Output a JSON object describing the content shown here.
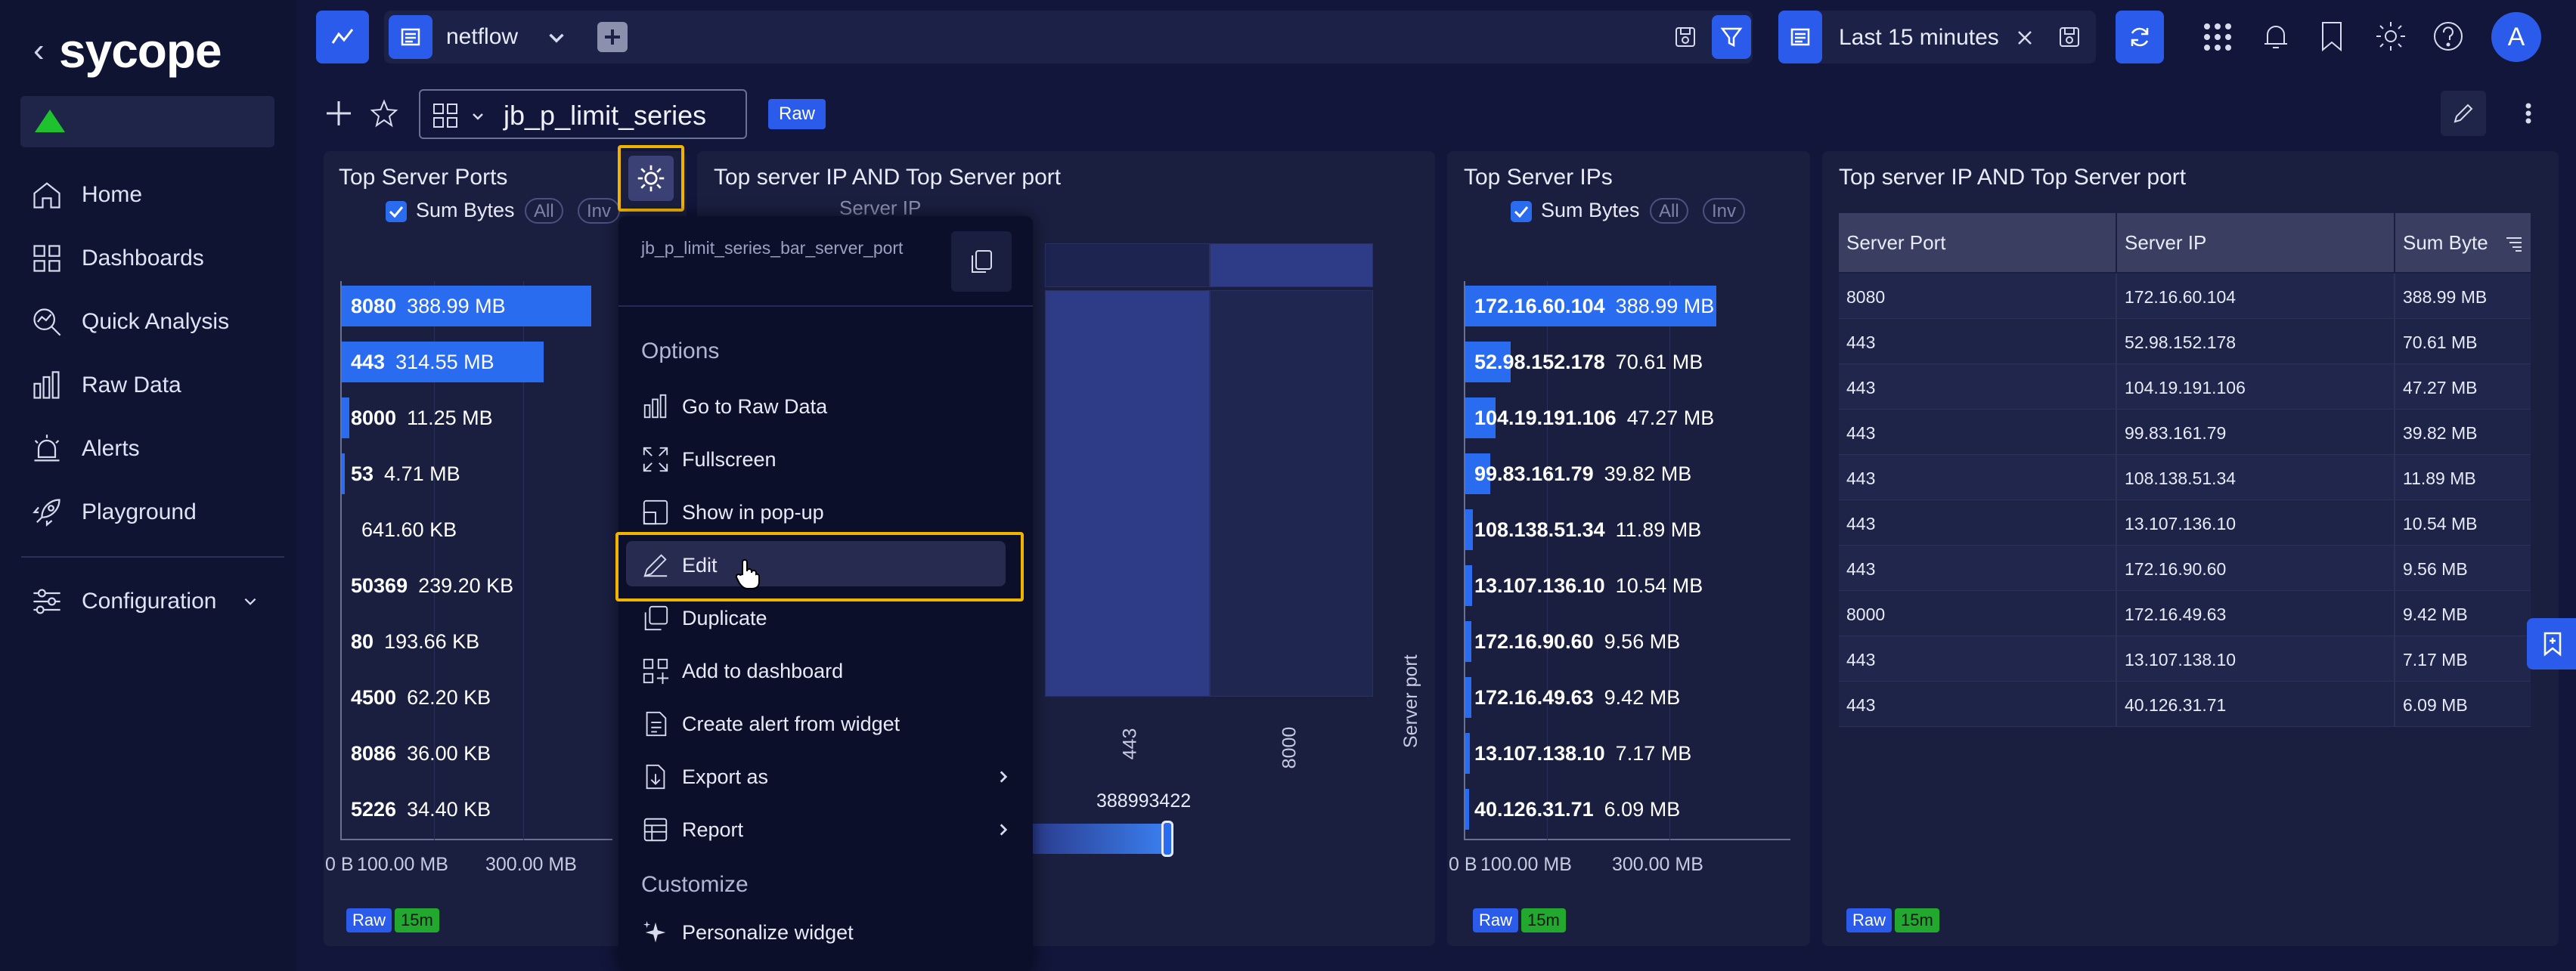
{
  "brand": {
    "logo_text": "sycope",
    "back_glyph": "‹"
  },
  "sidebar": {
    "items": [
      {
        "label": "Home"
      },
      {
        "label": "Dashboards"
      },
      {
        "label": "Quick Analysis"
      },
      {
        "label": "Raw Data"
      },
      {
        "label": "Alerts"
      },
      {
        "label": "Playground"
      },
      {
        "label": "Configuration"
      }
    ]
  },
  "topbar": {
    "source": "netflow",
    "time_range": "Last 15 minutes",
    "avatar": "A"
  },
  "dashboard": {
    "name": "jb_p_limit_series",
    "badge": "Raw"
  },
  "widgets": {
    "ports": {
      "title": "Top Server Ports",
      "series_label": "Sum Bytes",
      "pill_all": "All",
      "pill_inv": "Inv",
      "rows": [
        {
          "k": "8080",
          "v": "388.99 MB",
          "frac": 1.0
        },
        {
          "k": "443",
          "v": "314.55 MB",
          "frac": 0.81
        },
        {
          "k": "8000",
          "v": "11.25 MB",
          "frac": 0.03
        },
        {
          "k": "53",
          "v": "4.71 MB",
          "frac": 0.012
        },
        {
          "k": "",
          "v": "641.60 KB",
          "frac": 0.0
        },
        {
          "k": "50369",
          "v": "239.20 KB",
          "frac": 0.0
        },
        {
          "k": "80",
          "v": "193.66 KB",
          "frac": 0.0
        },
        {
          "k": "4500",
          "v": "62.20 KB",
          "frac": 0.0
        },
        {
          "k": "8086",
          "v": "36.00 KB",
          "frac": 0.0
        },
        {
          "k": "5226",
          "v": "34.40 KB",
          "frac": 0.0
        }
      ],
      "axis_ticks": [
        "0 B",
        "100.00 MB",
        "300.00 MB"
      ],
      "tag_raw": "Raw",
      "tag_time": "15m"
    },
    "heatmap": {
      "title": "Top server IP AND Top Server port",
      "x_title": "Server IP",
      "y_title": "Server port",
      "y_ticks": [
        "443",
        "8000"
      ],
      "legend_max": "388993422"
    },
    "ips": {
      "title": "Top Server IPs",
      "series_label": "Sum Bytes",
      "pill_all": "All",
      "pill_inv": "Inv",
      "rows": [
        {
          "k": "172.16.60.104",
          "v": "388.99 MB",
          "frac": 1.0
        },
        {
          "k": "52.98.152.178",
          "v": "70.61 MB",
          "frac": 0.18
        },
        {
          "k": "104.19.191.106",
          "v": "47.27 MB",
          "frac": 0.12
        },
        {
          "k": "99.83.161.79",
          "v": "39.82 MB",
          "frac": 0.1
        },
        {
          "k": "108.138.51.34",
          "v": "11.89 MB",
          "frac": 0.03
        },
        {
          "k": "13.107.136.10",
          "v": "10.54 MB",
          "frac": 0.027
        },
        {
          "k": "172.16.90.60",
          "v": "9.56 MB",
          "frac": 0.025
        },
        {
          "k": "172.16.49.63",
          "v": "9.42 MB",
          "frac": 0.024
        },
        {
          "k": "13.107.138.10",
          "v": "7.17 MB",
          "frac": 0.018
        },
        {
          "k": "40.126.31.71",
          "v": "6.09 MB",
          "frac": 0.016
        }
      ],
      "axis_ticks": [
        "0 B",
        "100.00 MB",
        "300.00 MB"
      ],
      "tag_raw": "Raw",
      "tag_time": "15m"
    },
    "table": {
      "title": "Top server IP AND Top Server port",
      "columns": [
        "Server Port",
        "Server IP",
        "Sum Byte"
      ],
      "rows": [
        [
          "8080",
          "172.16.60.104",
          "388.99 MB"
        ],
        [
          "443",
          "52.98.152.178",
          "70.61 MB"
        ],
        [
          "443",
          "104.19.191.106",
          "47.27 MB"
        ],
        [
          "443",
          "99.83.161.79",
          "39.82 MB"
        ],
        [
          "443",
          "108.138.51.34",
          "11.89 MB"
        ],
        [
          "443",
          "13.107.136.10",
          "10.54 MB"
        ],
        [
          "443",
          "172.16.90.60",
          "9.56 MB"
        ],
        [
          "8000",
          "172.16.49.63",
          "9.42 MB"
        ],
        [
          "443",
          "13.107.138.10",
          "7.17 MB"
        ],
        [
          "443",
          "40.126.31.71",
          "6.09 MB"
        ]
      ],
      "tag_raw": "Raw",
      "tag_time": "15m"
    }
  },
  "menu": {
    "widget_id": "jb_p_limit_series_bar_server_port",
    "section_options": "Options",
    "section_customize": "Customize",
    "items": [
      {
        "label": "Go to Raw Data"
      },
      {
        "label": "Fullscreen"
      },
      {
        "label": "Show in pop-up"
      },
      {
        "label": "Edit"
      },
      {
        "label": "Duplicate"
      },
      {
        "label": "Add to dashboard"
      },
      {
        "label": "Create alert from widget"
      },
      {
        "label": "Export as"
      },
      {
        "label": "Report"
      },
      {
        "label": "Personalize widget"
      }
    ]
  },
  "colors": {
    "accent": "#2a5bea",
    "bar": "#2a6cf0",
    "highlight": "#f0b400",
    "ok": "#1ec22f"
  }
}
